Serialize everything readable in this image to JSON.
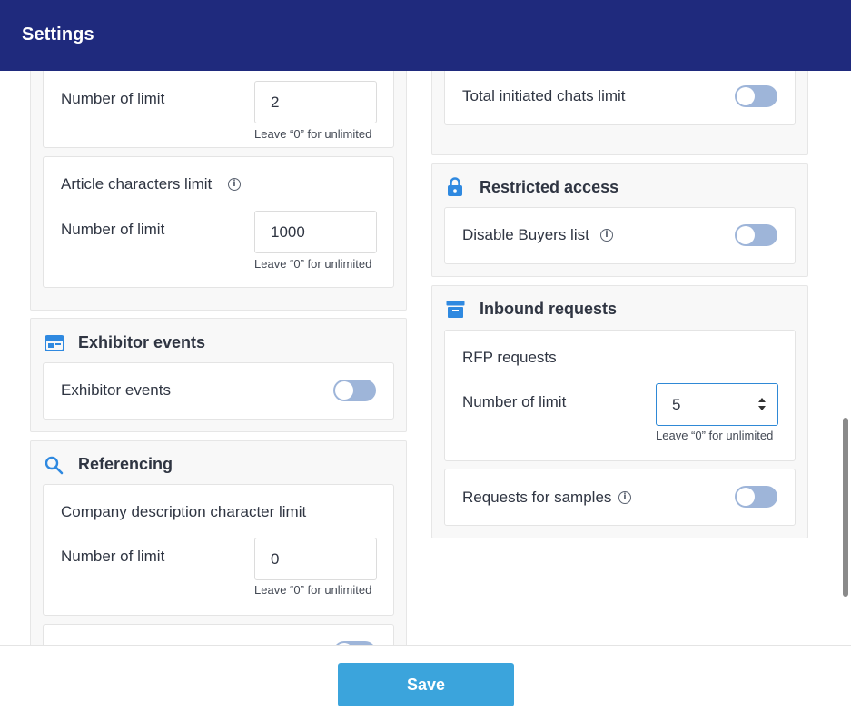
{
  "header": {
    "title": "Settings"
  },
  "left": {
    "limit_card_top": {
      "number_label": "Number of limit",
      "value": "2",
      "hint": "Leave “0” for unlimited"
    },
    "article_chars": {
      "label": "Article characters limit",
      "number_label": "Number of limit",
      "value": "1000",
      "hint": "Leave “0” for unlimited"
    },
    "exhibitor_events": {
      "title": "Exhibitor events",
      "toggle_label": "Exhibitor events",
      "enabled": false
    },
    "referencing": {
      "title": "Referencing",
      "company_desc_label": "Company description character limit",
      "number_label": "Number of limit",
      "value": "0",
      "hint": "Leave “0” for unlimited"
    }
  },
  "right": {
    "total_chats": {
      "label": "Total initiated chats limit",
      "enabled": false
    },
    "restricted_access": {
      "title": "Restricted access",
      "disable_buyers_label": "Disable Buyers list",
      "enabled": false
    },
    "inbound_requests": {
      "title": "Inbound requests",
      "rfp_label": "RFP requests",
      "number_label": "Number of limit",
      "value": "5",
      "hint": "Leave “0” for unlimited",
      "samples_label": "Requests for samples",
      "samples_enabled": false
    }
  },
  "footer": {
    "save_label": "Save"
  },
  "colors": {
    "header_bg": "#1f2a7d",
    "icon_blue": "#2f89e0",
    "toggle_off": "#9eb5d9",
    "save_bg": "#3ba4dc"
  }
}
